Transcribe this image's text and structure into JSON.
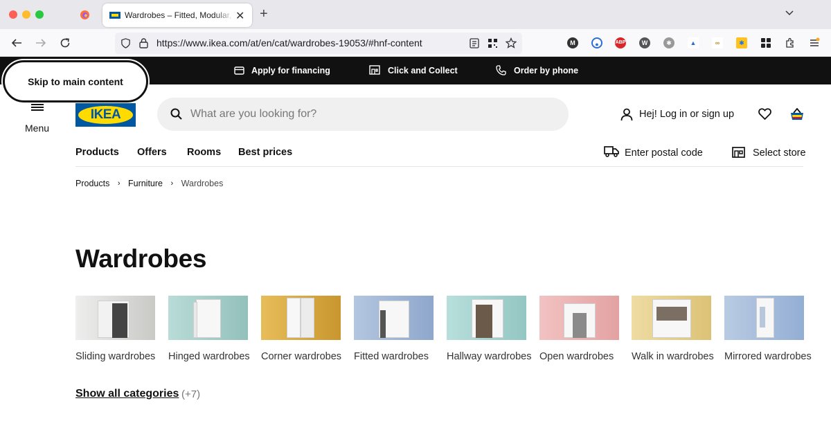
{
  "browser": {
    "tab_title": "Wardrobes – Fitted, Modular, Fr",
    "url": "https://www.ikea.com/at/en/cat/wardrobes-19053/#hnf-content"
  },
  "topbar": {
    "financing": "Apply for financing",
    "click_collect": "Click and Collect",
    "order_phone": "Order by phone"
  },
  "skip_link": "Skip to main content",
  "header": {
    "menu_label": "Menu",
    "logo_text": "IKEA",
    "search_placeholder": "What are you looking for?",
    "login_label": "Hej! Log in or sign up"
  },
  "main_nav": [
    "Products",
    "Offers",
    "Rooms",
    "Best prices"
  ],
  "postal_label": "Enter postal code",
  "store_label": "Select store",
  "breadcrumb": [
    "Products",
    "Furniture",
    "Wardrobes"
  ],
  "page_title": "Wardrobes",
  "categories": [
    {
      "label": "Sliding wardrobes",
      "bg": "#d5d5d2"
    },
    {
      "label": "Hinged wardrobes",
      "bg": "#9fc7c3"
    },
    {
      "label": "Corner wardrobes",
      "bg": "#d9a843"
    },
    {
      "label": "Fitted wardrobes",
      "bg": "#9fb5d6"
    },
    {
      "label": "Hallway wardrobes",
      "bg": "#a6d2cf"
    },
    {
      "label": "Open wardrobes",
      "bg": "#ecb2b2"
    },
    {
      "label": "Walk in wardrobes",
      "bg": "#e6d08d"
    },
    {
      "label": "Mirrored wardrobes",
      "bg": "#a8bedc"
    }
  ],
  "show_all": {
    "label": "Show all categories",
    "count": "(+7)"
  },
  "colors": {
    "ikea_blue": "#0058a3",
    "ikea_yellow": "#ffdb00"
  }
}
